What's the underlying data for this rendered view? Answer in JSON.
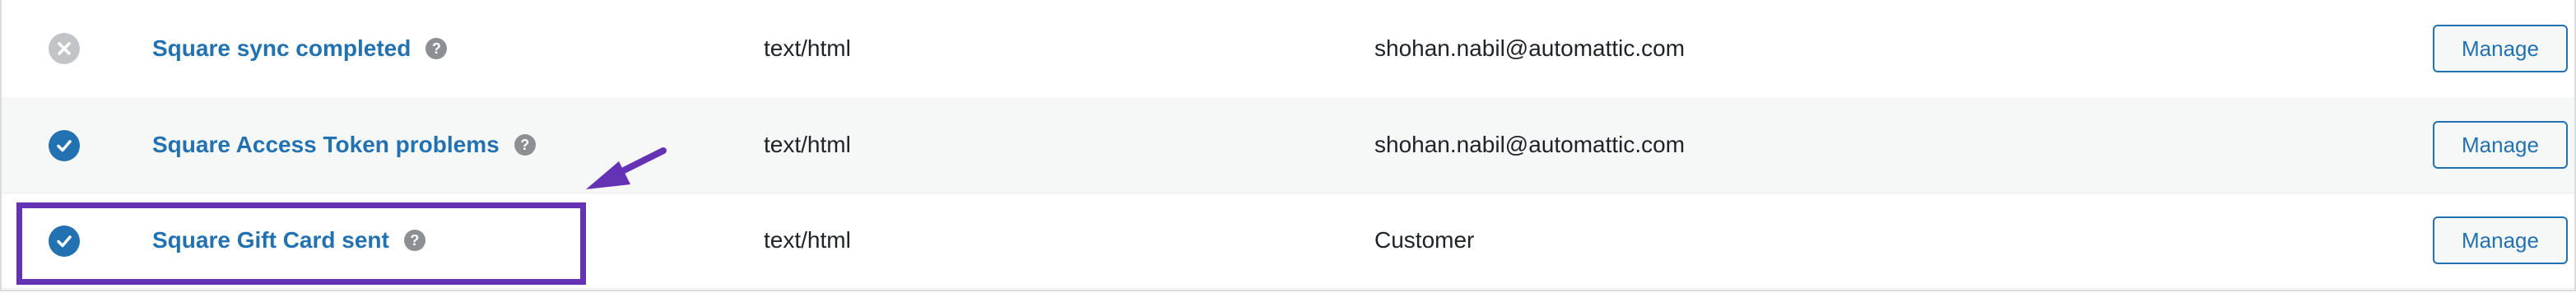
{
  "table": {
    "rows": [
      {
        "status": "disabled",
        "status_icon": "x-circle-icon",
        "title": "Square sync completed",
        "help": "?",
        "content_type": "text/html",
        "recipient": "shohan.nabil@automattic.com",
        "action": "Manage"
      },
      {
        "status": "enabled",
        "status_icon": "check-circle-icon",
        "title": "Square Access Token problems",
        "help": "?",
        "content_type": "text/html",
        "recipient": "shohan.nabil@automattic.com",
        "action": "Manage"
      },
      {
        "status": "enabled",
        "status_icon": "check-circle-icon",
        "title": "Square Gift Card sent",
        "help": "?",
        "content_type": "text/html",
        "recipient": "Customer",
        "action": "Manage"
      }
    ]
  },
  "colors": {
    "link": "#2271b1",
    "annotation": "#6432b4",
    "disabled": "#c3c4c7",
    "row_alt": "#f6f7f7"
  },
  "annotation": {
    "highlighted_row": 3,
    "arrow_icon": "arrow-icon"
  }
}
